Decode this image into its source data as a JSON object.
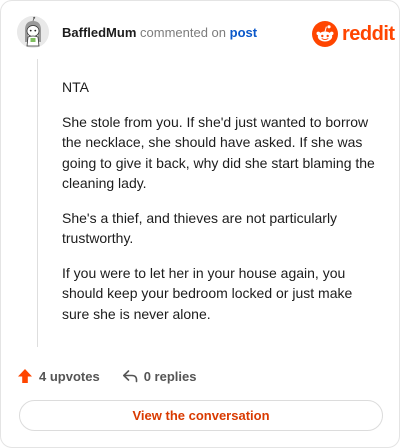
{
  "header": {
    "username": "BaffledMum",
    "action_text": "commented on",
    "post_link": "post",
    "brand_word": "reddit",
    "avatar_icon": "snoo-avatar-icon",
    "brand_icon": "reddit-logo-icon"
  },
  "comment": {
    "paragraphs": [
      "NTA",
      "She stole from you. If she'd just wanted to borrow the necklace, she should have asked. If she was going to give it back, why did she start blaming the cleaning lady.",
      "She's a thief, and thieves are not particularly trustworthy.",
      "If you were to let her in your house again, you should keep your bedroom locked or just make sure she is never alone."
    ]
  },
  "footer": {
    "upvotes": "4 upvotes",
    "replies": "0 replies",
    "upvote_icon": "upvote-arrow-icon",
    "reply_icon": "reply-icon",
    "view_conversation": "View the conversation"
  },
  "colors": {
    "brand": "#ff4500",
    "link": "#0a58ca",
    "cta_text": "#d93a00"
  }
}
